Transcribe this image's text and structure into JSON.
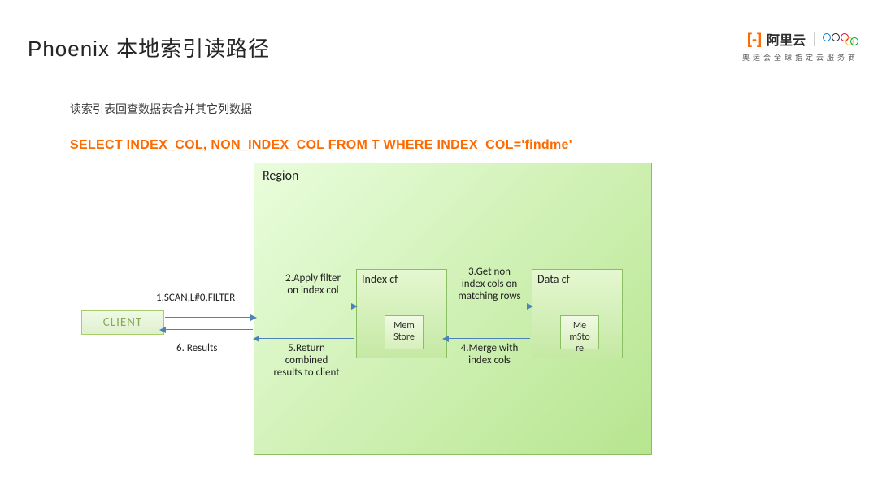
{
  "title": "Phoenix 本地索引读路径",
  "logo": {
    "bracket": "[-]",
    "brand": "阿里云",
    "subtitle": "奥运会全球指定云服务商"
  },
  "description": "读索引表回查数据表合并其它列数据",
  "sql": "SELECT INDEX_COL, NON_INDEX_COL FROM T WHERE INDEX_COL='findme'",
  "diagram": {
    "client": "CLIENT",
    "region": "Region",
    "index_cf": "Index cf",
    "data_cf": "Data cf",
    "mem1_l1": "Mem",
    "mem1_l2": "Store",
    "mem2_l1": "Me",
    "mem2_l2": "mSto",
    "mem2_l3": "re",
    "step1": "1.SCAN,L#0,FILTER",
    "step2_l1": "2.Apply filter",
    "step2_l2": "on index col",
    "step3_l1": "3.Get non",
    "step3_l2": "index cols on",
    "step3_l3": "matching rows",
    "step4_l1": "4.Merge with",
    "step4_l2": "index cols",
    "step5_l1": "5.Return",
    "step5_l2": "combined",
    "step5_l3": "results to client",
    "step6": "6. Results"
  }
}
